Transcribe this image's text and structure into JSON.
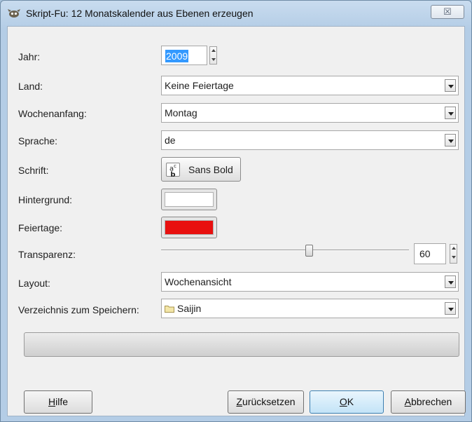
{
  "window": {
    "title": "Skript-Fu: 12 Monatskalender aus Ebenen erzeugen",
    "close_label": "☒"
  },
  "fields": {
    "year": {
      "label": "Jahr:",
      "value": "2009"
    },
    "country": {
      "label": "Land:",
      "value": "Keine Feiertage"
    },
    "week_start": {
      "label": "Wochenanfang:",
      "value": "Montag"
    },
    "language": {
      "label": "Sprache:",
      "value": "de"
    },
    "font": {
      "label": "Schrift:",
      "value": "Sans Bold",
      "icon": "font-icon"
    },
    "background": {
      "label": "Hintergrund:",
      "color": "#ffffff"
    },
    "holidays": {
      "label": "Feiertage:",
      "color": "#e8100f"
    },
    "transparency": {
      "label": "Transparenz:",
      "value": "60",
      "min": 0,
      "max": 100
    },
    "layout": {
      "label": "Layout:",
      "value": "Wochenansicht"
    },
    "save_dir": {
      "label": "Verzeichnis zum Speichern:",
      "value": "Saijin",
      "icon": "folder-icon"
    }
  },
  "buttons": {
    "help": {
      "prefix": "",
      "mnemonic": "H",
      "rest": "ilfe"
    },
    "reset": {
      "prefix": "",
      "mnemonic": "Z",
      "rest": "urücksetzen"
    },
    "ok": {
      "prefix": "",
      "mnemonic": "O",
      "rest": "K"
    },
    "cancel": {
      "prefix": "",
      "mnemonic": "A",
      "rest": "bbrechen"
    }
  }
}
